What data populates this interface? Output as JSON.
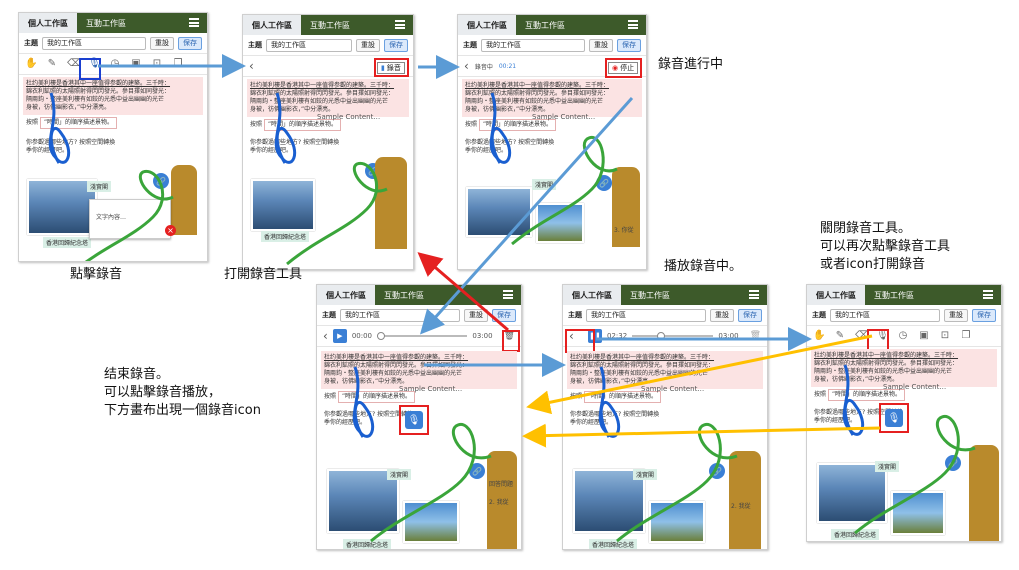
{
  "app": {
    "tab_personal": "個人工作區",
    "tab_interactive": "互動工作區",
    "topic_label": "主題",
    "topic_value": "我的工作區",
    "reset_label": "重設",
    "save_label": "保存"
  },
  "canvas_text": {
    "pink_line1": "杜约美利樓是香港其中一座值得参觀的建築。三千時：",
    "pink_line2": "錦衣利鉱照的太陽照射得閃閃發光。參目擇如同發光：",
    "pink_line3": "隔兩鈞・整座美利樓有如鉸的光悉中益出幽幽的光芒",
    "pink_line4": "身被，彷佛幽影衣，”中分漂亮。",
    "order_line": "按照",
    "order_box": "”時間」的順序描述景物。",
    "question_line": "你参觀過哪些地方? 按照空間轉換",
    "question_line2": "季你的經歷吧。",
    "caption_night": "淺實閣",
    "caption_hk": "香港回歸紀念塔",
    "text_content": "文字內容…",
    "sample_content": "Sample Content…",
    "list_right": "回答問題",
    "list_2": "2. 我從",
    "list_3": "3. 你從"
  },
  "panel2": {
    "record_label": "錄音"
  },
  "panel3": {
    "recording_label": "錄音中",
    "recording_time": "00:21",
    "stop_label": "停止"
  },
  "panel4": {
    "time_start": "00:00",
    "time_end": "03:00"
  },
  "panel5": {
    "time_start": "02:32",
    "time_end": "03:00"
  },
  "annotations": {
    "click_record": "點擊錄音",
    "open_tool": "打開錄音工具",
    "recording_progress": "錄音進行中",
    "playing": "播放錄音中。",
    "close_tool_1": "關閉錄音工具。",
    "close_tool_2": "可以再次點擊錄音工具",
    "close_tool_3": "或者icon打開錄音",
    "end_1": "结束錄音。",
    "end_2": "可以點擊錄音播放，",
    "end_3": "下方畫布出現一個錄音icon"
  },
  "colors": {
    "tab_bar": "#3d5a2a",
    "accent_blue": "#3a7fd5",
    "highlight_red": "#e52020",
    "arrow_blue": "#5b9bd5",
    "arrow_orange": "#ffc000",
    "pink_bg": "#fbe3e3"
  },
  "icons": [
    "hand-icon",
    "pen-icon",
    "eraser-icon",
    "mic-icon",
    "timer-icon",
    "image-icon",
    "text-icon",
    "copy-icon",
    "chevron-left-icon",
    "menu-icon",
    "trash-icon",
    "play-icon",
    "pause-icon",
    "link-icon",
    "zoom-icon",
    "close-icon"
  ]
}
